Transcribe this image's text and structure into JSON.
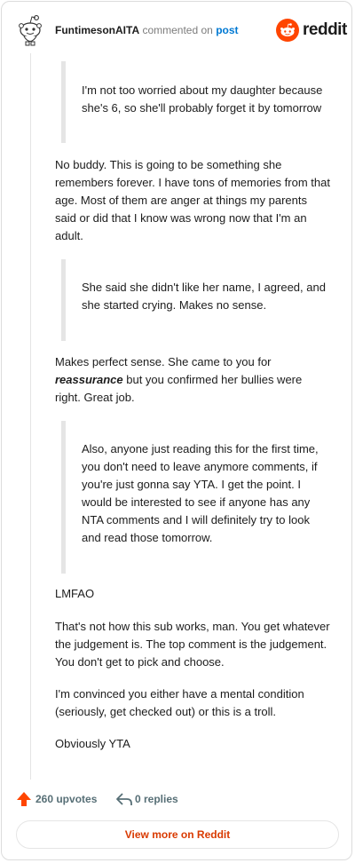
{
  "header": {
    "username": "FuntimesonAITA",
    "commented_on": "commented on",
    "post_link": "post",
    "brand": "reddit"
  },
  "comment": {
    "quote1": "I'm not too worried about my daughter because she's 6, so she'll probably forget it by tomorrow",
    "para1": "No buddy. This is going to be something she remembers forever. I have tons of memories from that age. Most of them are anger at things my parents said or did that I know was wrong now that I'm an adult.",
    "quote2": "She said she didn't like her name, I agreed, and she started crying. Makes no sense.",
    "para2_before": "Makes perfect sense. She came to you for ",
    "para2_emphasis": "reassurance",
    "para2_after": " but you confirmed her bullies were right. Great job.",
    "quote3": "Also, anyone just reading this for the first time, you don't need to leave anymore comments, if you're just gonna say YTA. I get the point. I would be interested to see if anyone has any NTA comments and I will definitely try to look and read those tomorrow.",
    "para3": "LMFAO",
    "para4": "That's not how this sub works, man. You get whatever the judgement is. The top comment is the judgement. You don't get to pick and choose.",
    "para5": "I'm convinced you either have a mental condition (seriously, get checked out) or this is a troll.",
    "para6": "Obviously YTA"
  },
  "footer": {
    "upvotes": "260 upvotes",
    "replies": "0 replies",
    "view_more": "View more on Reddit"
  },
  "colors": {
    "brand_orange": "#ff4500",
    "link_blue": "#0079d3",
    "view_more_text": "#d93a00",
    "meta_gray": "#576f76"
  },
  "icons": {
    "avatar": "snoo-avatar-icon",
    "brand": "reddit-logo-icon",
    "upvote": "upvote-arrow-icon",
    "reply": "reply-arrow-icon"
  }
}
